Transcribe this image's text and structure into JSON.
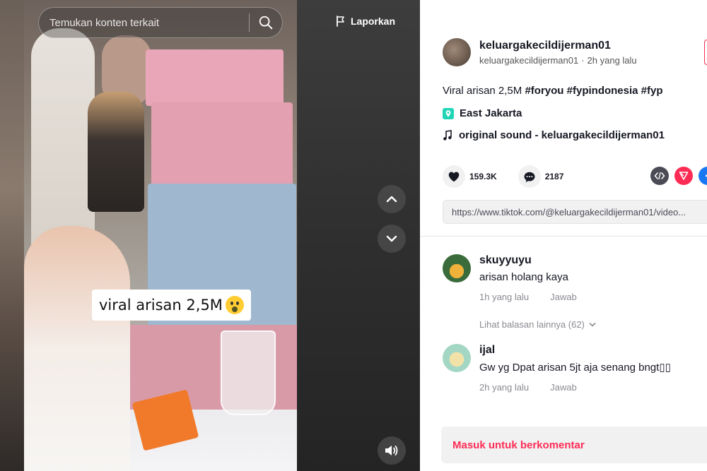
{
  "video": {
    "search_placeholder": "Temukan konten terkait",
    "report_label": "Laporkan",
    "caption": "viral arisan 2,5M"
  },
  "author": {
    "name": "keluargakecildijerman01",
    "handle": "keluargakecildijerman01",
    "separator": "·",
    "time": "2h yang lalu"
  },
  "description": {
    "text": "Viral arisan 2,5M",
    "hashtags": [
      "#foryou",
      "#fypindonesia",
      "#fyp"
    ]
  },
  "location": "East Jakarta",
  "sound": "original sound - keluargakecildijerman01",
  "stats": {
    "likes": "159.3K",
    "comments": "2187"
  },
  "share_link": "https://www.tiktok.com/@keluargakecildijerman01/video...",
  "comments": [
    {
      "user": "skuyyuyu",
      "text": "arisan holang kaya",
      "time": "1h yang lalu",
      "reply_label": "Jawab",
      "more_replies": "Lihat balasan lainnya (62)"
    },
    {
      "user": "ijal",
      "text": "Gw yg Dpat arisan 5jt aja senang bngt▯▯",
      "time": "2h yang lalu",
      "reply_label": "Jawab"
    }
  ],
  "login_prompt": "Masuk untuk berkomentar",
  "colors": {
    "accent": "#fe2c55",
    "location_icon": "#20d5b6",
    "share_embed": "#4b4b55",
    "share_send": "#fe2c55",
    "share_facebook": "#1877f2"
  },
  "icons": {
    "search": "search-icon",
    "report": "flag-icon",
    "nav_up": "chevron-up-icon",
    "nav_down": "chevron-down-icon",
    "volume": "volume-icon",
    "location": "location-pin-icon",
    "sound": "music-note-icon",
    "like": "heart-icon",
    "comment": "comment-bubble-icon",
    "embed": "embed-code-icon",
    "send": "send-icon",
    "facebook": "facebook-icon"
  }
}
